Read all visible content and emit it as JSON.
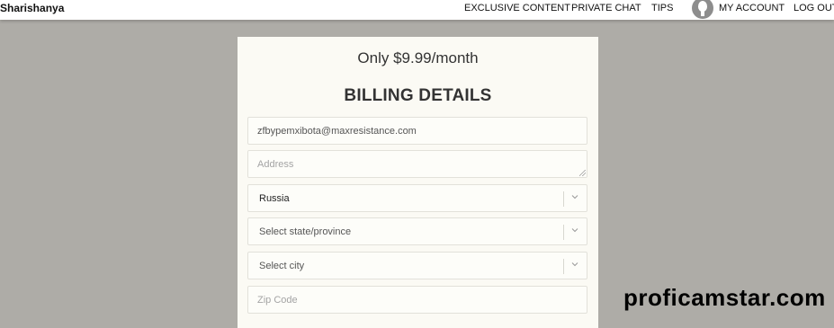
{
  "header": {
    "brand": "Sharishanya",
    "nav": {
      "exclusive_content": "EXCLUSIVE CONTENT",
      "private_chat": "PRIVATE CHAT",
      "tips": "TIPS",
      "my_account": "MY ACCOUNT",
      "log_out": "LOG OUT"
    },
    "avatar_icon": "user-silhouette-icon"
  },
  "billing": {
    "price_text": "Only $9.99/month",
    "title": "BILLING DETAILS",
    "email_value": "zfbypemxibota@maxresistance.com",
    "address_placeholder": "Address",
    "country_value": "Russia",
    "state_placeholder": "Select state/province",
    "city_placeholder": "Select city",
    "zip_placeholder": "Zip Code",
    "chevron_icon": "chevron-down-icon"
  },
  "watermark": "proficamstar.com",
  "colors": {
    "page_background": "#aeaca7",
    "panel_background": "#fbfaf4",
    "header_background": "#ffffff"
  }
}
